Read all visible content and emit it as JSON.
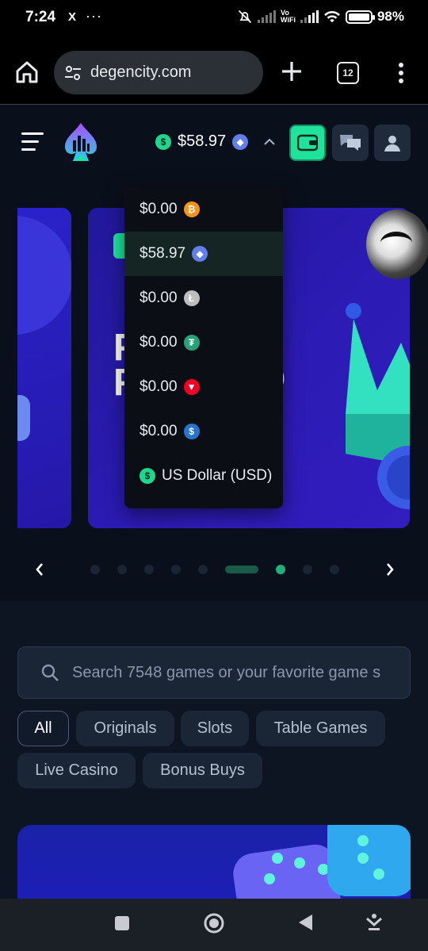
{
  "status_bar": {
    "time": "7:24",
    "x_icon": "X",
    "more": "···",
    "vowifi": "Vo\nWiFi",
    "battery_pct": "98%"
  },
  "browser": {
    "url": "degencity.com",
    "tab_count": "12"
  },
  "header": {
    "balance": "$58.97",
    "balance_coin": "ETH",
    "balance_usd_icon": "$"
  },
  "dropdown": {
    "items": [
      {
        "amount": "$0.00",
        "coin": "btc",
        "glyph": "₿"
      },
      {
        "amount": "$58.97",
        "coin": "eth",
        "glyph": "◆",
        "selected": true
      },
      {
        "amount": "$0.00",
        "coin": "ltc",
        "glyph": "Ł"
      },
      {
        "amount": "$0.00",
        "coin": "usdt",
        "glyph": "₮"
      },
      {
        "amount": "$0.00",
        "coin": "trx",
        "glyph": "▼"
      },
      {
        "amount": "$0.00",
        "coin": "usdc",
        "glyph": "$"
      },
      {
        "amount": "US Dollar (USD)",
        "coin": "usd",
        "glyph": "$"
      }
    ]
  },
  "hero": {
    "line1": "F",
    "line2": "F",
    "line2b": "O"
  },
  "search": {
    "placeholder": "Search 7548 games or your favorite game s"
  },
  "filters": [
    "All",
    "Originals",
    "Slots",
    "Table Games",
    "Live Casino",
    "Bonus Buys"
  ],
  "colors": {
    "accent": "#1fe39b",
    "bg": "#0d1522",
    "header": "#0a0f1c",
    "chip": "#1a2536"
  }
}
